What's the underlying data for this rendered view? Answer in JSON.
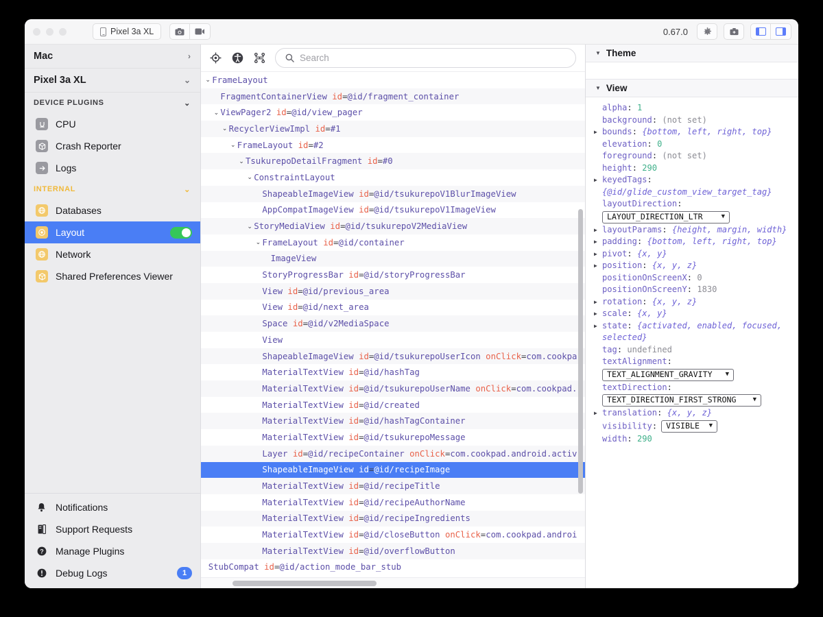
{
  "titlebar": {
    "device_pill": "Pixel 3a XL",
    "phone_icon": "phone-icon",
    "screenshot_icon": "camera-icon",
    "record_icon": "video-camera-icon",
    "version": "0.67.0",
    "settings_icon": "gear-icon",
    "bug_icon": "briefcase-icon",
    "left_panel_icon": "left-panel-toggle-icon",
    "right_panel_icon": "right-panel-toggle-icon"
  },
  "sidebar": {
    "devices": [
      {
        "label": "Mac",
        "chevron": "›"
      },
      {
        "label": "Pixel 3a XL",
        "chevron": "⌄"
      }
    ],
    "sections": [
      {
        "title": "DEVICE PLUGINS",
        "chevron": "⌄",
        "items": [
          {
            "label": "CPU",
            "icon": "cpu-icon",
            "glyph": "U"
          },
          {
            "label": "Crash Reporter",
            "icon": "box-icon",
            "glyph": "⬡"
          },
          {
            "label": "Logs",
            "icon": "arrow-right-icon",
            "glyph": "→"
          }
        ]
      },
      {
        "title": "INTERNAL",
        "chevron": "⌄",
        "items": [
          {
            "label": "Databases",
            "icon": "globe-icon",
            "glyph": "⊕"
          },
          {
            "label": "Layout",
            "icon": "layout-icon",
            "glyph": "◉",
            "active": true,
            "toggle": true
          },
          {
            "label": "Network",
            "icon": "globe-icon",
            "glyph": "⊕"
          },
          {
            "label": "Shared Preferences Viewer",
            "icon": "box-icon",
            "glyph": "⬡"
          }
        ]
      }
    ],
    "bottom_items": [
      {
        "label": "Notifications",
        "icon": "bell-icon"
      },
      {
        "label": "Support Requests",
        "icon": "book-icon"
      },
      {
        "label": "Manage Plugins",
        "icon": "question-circle-icon"
      },
      {
        "label": "Debug Logs",
        "icon": "info-circle-icon",
        "badge": "1"
      }
    ]
  },
  "tree": {
    "toolbar_icons": [
      "target-icon",
      "accessibility-icon",
      "hierarchy-icon"
    ],
    "search_placeholder": "Search",
    "search_icon": "search-icon",
    "rows": [
      {
        "indent": 0,
        "arrow": "⌄",
        "tag": "FrameLayout"
      },
      {
        "indent": 1,
        "tag": "FragmentContainerView",
        "attr": "id",
        "val": "@id/fragment_container"
      },
      {
        "indent": 1,
        "arrow": "⌄",
        "tag": "ViewPager2",
        "attr": "id",
        "val": "@id/view_pager"
      },
      {
        "indent": 2,
        "arrow": "⌄",
        "tag": "RecyclerViewImpl",
        "attr": "id",
        "val": "#1"
      },
      {
        "indent": 3,
        "arrow": "⌄",
        "tag": "FrameLayout",
        "attr": "id",
        "val": "#2"
      },
      {
        "indent": 4,
        "arrow": "⌄",
        "tag": "TsukurepoDetailFragment",
        "attr": "id",
        "val": "#0"
      },
      {
        "indent": 5,
        "arrow": "⌄",
        "tag": "ConstraintLayout"
      },
      {
        "indent": 6,
        "tag": "ShapeableImageView",
        "attr": "id",
        "val": "@id/tsukurepoV1BlurImageView"
      },
      {
        "indent": 6,
        "tag": "AppCompatImageView",
        "attr": "id",
        "val": "@id/tsukurepoV1ImageView"
      },
      {
        "indent": 5,
        "arrow": "⌄",
        "tag": "StoryMediaView",
        "attr": "id",
        "val": "@id/tsukurepoV2MediaView"
      },
      {
        "indent": 6,
        "arrow": "⌄",
        "tag": "FrameLayout",
        "attr": "id",
        "val": "@id/container"
      },
      {
        "indent": 7,
        "tag": "ImageView"
      },
      {
        "indent": 6,
        "tag": "StoryProgressBar",
        "attr": "id",
        "val": "@id/storyProgressBar"
      },
      {
        "indent": 6,
        "tag": "View",
        "attr": "id",
        "val": "@id/previous_area"
      },
      {
        "indent": 6,
        "tag": "View",
        "attr": "id",
        "val": "@id/next_area"
      },
      {
        "indent": 6,
        "tag": "Space",
        "attr": "id",
        "val": "@id/v2MediaSpace"
      },
      {
        "indent": 6,
        "tag": "View"
      },
      {
        "indent": 6,
        "tag": "ShapeableImageView",
        "attr": "id",
        "val": "@id/tsukurepoUserIcon",
        "attr2": "onClick",
        "val2": "com.cookpa"
      },
      {
        "indent": 6,
        "tag": "MaterialTextView",
        "attr": "id",
        "val": "@id/hashTag"
      },
      {
        "indent": 6,
        "tag": "MaterialTextView",
        "attr": "id",
        "val": "@id/tsukurepoUserName",
        "attr2": "onClick",
        "val2": "com.cookpad."
      },
      {
        "indent": 6,
        "tag": "MaterialTextView",
        "attr": "id",
        "val": "@id/created"
      },
      {
        "indent": 6,
        "tag": "MaterialTextView",
        "attr": "id",
        "val": "@id/hashTagContainer"
      },
      {
        "indent": 6,
        "tag": "MaterialTextView",
        "attr": "id",
        "val": "@id/tsukurepoMessage"
      },
      {
        "indent": 6,
        "tag": "Layer",
        "attr": "id",
        "val": "@id/recipeContainer",
        "attr2": "onClick",
        "val2": "com.cookpad.android.activ"
      },
      {
        "indent": 6,
        "tag": "ShapeableImageView",
        "attr": "id",
        "val": "@id/recipeImage",
        "selected": true
      },
      {
        "indent": 6,
        "tag": "MaterialTextView",
        "attr": "id",
        "val": "@id/recipeTitle"
      },
      {
        "indent": 6,
        "tag": "MaterialTextView",
        "attr": "id",
        "val": "@id/recipeAuthorName"
      },
      {
        "indent": 6,
        "tag": "MaterialTextView",
        "attr": "id",
        "val": "@id/recipeIngredients"
      },
      {
        "indent": 6,
        "tag": "MaterialTextView",
        "attr": "id",
        "val": "@id/closeButton",
        "attr2": "onClick",
        "val2": "com.cookpad.androi"
      },
      {
        "indent": 6,
        "tag": "MaterialTextView",
        "attr": "id",
        "val": "@id/overflowButton"
      },
      {
        "indent": -1,
        "tag": "StubCompat",
        "attr": "id",
        "val": "@id/action_mode_bar_stub"
      }
    ]
  },
  "inspector": {
    "theme_header": "Theme",
    "view_header": "View",
    "properties": [
      {
        "disc": false,
        "name": "alpha",
        "value": "1",
        "kind": "num"
      },
      {
        "disc": false,
        "name": "background",
        "value": "(not set)",
        "kind": "gray"
      },
      {
        "disc": true,
        "name": "bounds",
        "value": "{bottom, left, right, top}",
        "kind": "obj"
      },
      {
        "disc": false,
        "name": "elevation",
        "value": "0",
        "kind": "num"
      },
      {
        "disc": false,
        "name": "foreground",
        "value": "(not set)",
        "kind": "gray"
      },
      {
        "disc": false,
        "name": "height",
        "value": "290",
        "kind": "num"
      },
      {
        "disc": true,
        "name": "keyedTags",
        "value": "",
        "kind": "none",
        "wrap": "{@id/glide_custom_view_target_tag}"
      },
      {
        "disc": false,
        "name": "layoutDirection",
        "value": "",
        "kind": "none",
        "select": "LAYOUT_DIRECTION_LTR",
        "select_width": "186"
      },
      {
        "disc": true,
        "name": "layoutParams",
        "value": "{height, margin, width}",
        "kind": "obj"
      },
      {
        "disc": true,
        "name": "padding",
        "value": "{bottom, left, right, top}",
        "kind": "obj"
      },
      {
        "disc": true,
        "name": "pivot",
        "value": "{x, y}",
        "kind": "obj"
      },
      {
        "disc": true,
        "name": "position",
        "value": "{x, y, z}",
        "kind": "obj"
      },
      {
        "disc": false,
        "name": "positionOnScreenX",
        "value": "0",
        "kind": "gray"
      },
      {
        "disc": false,
        "name": "positionOnScreenY",
        "value": "1830",
        "kind": "gray"
      },
      {
        "disc": true,
        "name": "rotation",
        "value": "{x, y, z}",
        "kind": "obj"
      },
      {
        "disc": true,
        "name": "scale",
        "value": "{x, y}",
        "kind": "obj"
      },
      {
        "disc": true,
        "name": "state",
        "value": "{activated, enabled, focused,",
        "kind": "obj",
        "wrap": "selected}"
      },
      {
        "disc": false,
        "name": "tag",
        "value": "undefined",
        "kind": "gray"
      },
      {
        "disc": false,
        "name": "textAlignment",
        "value": "",
        "kind": "none",
        "select": "TEXT_ALIGNMENT_GRAVITY",
        "select_width": "192"
      },
      {
        "disc": false,
        "name": "textDirection",
        "value": "",
        "kind": "none",
        "select": "TEXT_DIRECTION_FIRST_STRONG",
        "select_width": "232"
      },
      {
        "disc": true,
        "name": "translation",
        "value": "{x, y, z}",
        "kind": "obj"
      },
      {
        "disc": false,
        "name": "visibility",
        "value": "",
        "kind": "none",
        "select_inline": "VISIBLE",
        "select_width": "82"
      },
      {
        "disc": false,
        "name": "width",
        "value": "290",
        "kind": "num"
      }
    ]
  },
  "colors": {
    "accent_blue": "#4a7ef5",
    "toggle_green": "#35c759",
    "tag_purple": "#5c4fa8",
    "attr_orange": "#e8624a",
    "num_green": "#3fb08a",
    "internal_amber": "#f0b93b"
  }
}
